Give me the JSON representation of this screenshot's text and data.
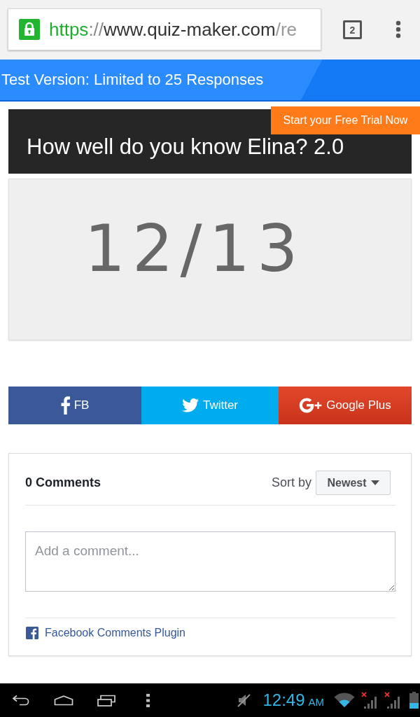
{
  "browser_bar": {
    "url_segments": [
      {
        "text": "https",
        "kind": "scheme"
      },
      {
        "text": "://",
        "kind": "separator"
      },
      {
        "text": "www.quiz-maker.com",
        "kind": "host"
      },
      {
        "text": "/re",
        "kind": "path"
      }
    ],
    "tab_count": "2"
  },
  "banner": {
    "text": "Test Version: Limited to 25 Responses"
  },
  "trial_button": {
    "label": "Start your Free Trial Now"
  },
  "quiz": {
    "title": "How well do you know Elina? 2.0",
    "score": "12/13"
  },
  "share_buttons": [
    {
      "kind": "facebook",
      "label": "FB"
    },
    {
      "kind": "twitter",
      "label": "Twitter"
    },
    {
      "kind": "googleplus",
      "label": "Google Plus"
    }
  ],
  "comments": {
    "count": "0 Comments",
    "sort_label": "Sort by",
    "sort_value": "Newest",
    "placeholder": "Add a comment...",
    "plugin_link": "Facebook Comments Plugin"
  },
  "system_bar": {
    "time": "12:49",
    "meridiem": "AM"
  }
}
